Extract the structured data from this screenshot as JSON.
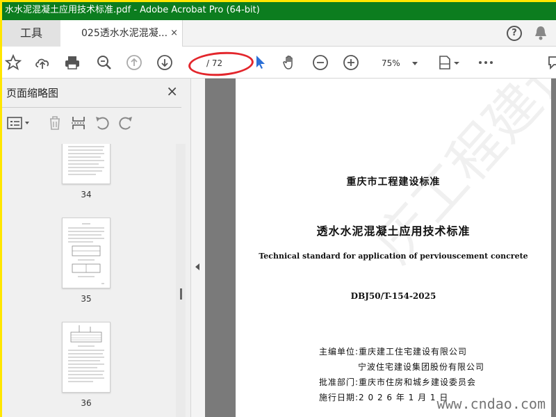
{
  "window": {
    "title": "水水泥混凝土应用技术标准.pdf - Adobe Acrobat Pro (64-bit)"
  },
  "tabs": {
    "tools_label": "工具",
    "doc_label": "025透水水泥混凝...",
    "close_glyph": "×"
  },
  "toolbar": {
    "page_display": "/ 72",
    "zoom_value": "75%"
  },
  "sidebar": {
    "title": "页面缩略图",
    "close_glyph": "×",
    "thumbnails": [
      {
        "label": "34"
      },
      {
        "label": "35"
      },
      {
        "label": "36"
      }
    ]
  },
  "document": {
    "issuer": "重庆市工程建设标准",
    "title_cn": "透水水泥混凝土应用技术标准",
    "title_en": "Technical standard for application of perviouscement concrete",
    "code": "DBJ50/T-154-2025",
    "lines": [
      "主编单位:重庆建工住宅建设有限公司",
      "宁波住宅建设集团股份有限公司",
      "批准部门:重庆市住房和城乡建设委员会",
      "施行日期:2 0 2 6 年 1 月 1 日"
    ]
  },
  "watermark_site": "www.cndao.com",
  "accent_colors": {
    "titlebar": "#0c7d1f",
    "annotation": "#e3262c",
    "cursor": "#2b6fd6"
  }
}
